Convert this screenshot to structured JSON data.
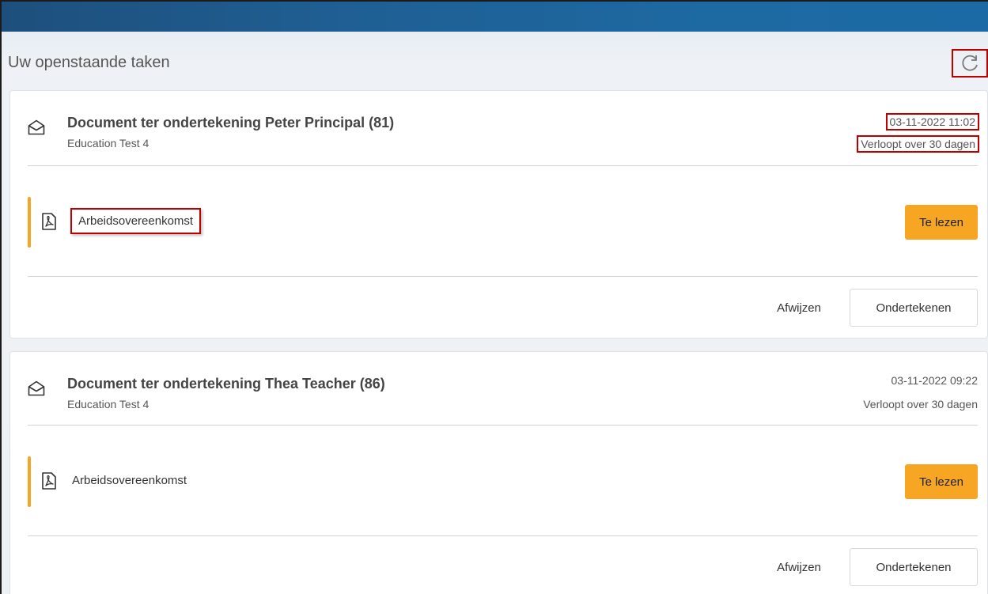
{
  "header": {
    "section_title": "Uw openstaande taken",
    "refresh_icon": "refresh-icon"
  },
  "colors": {
    "topbar": "#1d5f94",
    "accent_orange": "#f6a623",
    "highlight_red": "#c00000"
  },
  "tasks": [
    {
      "icon": "envelope-icon",
      "title": "Document ter ondertekening Peter Principal (81)",
      "subtitle": "Education Test 4",
      "date": "03-11-2022 11:02",
      "expires": "Verloopt over 30 dagen",
      "document": {
        "icon": "pdf-icon",
        "name": "Arbeidsovereenkomst",
        "action_label": "Te lezen"
      },
      "reject_label": "Afwijzen",
      "sign_label": "Ondertekenen"
    },
    {
      "icon": "envelope-icon",
      "title": "Document ter ondertekening Thea Teacher (86)",
      "subtitle": "Education Test 4",
      "date": "03-11-2022 09:22",
      "expires": "Verloopt over 30 dagen",
      "document": {
        "icon": "pdf-icon",
        "name": "Arbeidsovereenkomst",
        "action_label": "Te lezen"
      },
      "reject_label": "Afwijzen",
      "sign_label": "Ondertekenen"
    }
  ]
}
